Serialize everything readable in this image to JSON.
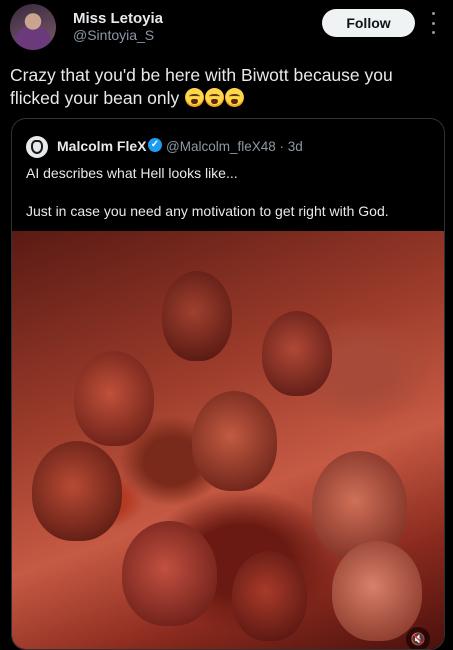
{
  "post": {
    "author_name": "Miss Letoyia",
    "author_handle": "@Sintoyia_S",
    "follow_label": "Follow",
    "text": "Crazy that you'd be here with Biwott because you flicked your bean only"
  },
  "quote": {
    "author_name": "Malcolm FleX",
    "author_handle": "@Malcolm_fleX48",
    "separator": "·",
    "time": "3d",
    "text_line1": "AI describes what Hell looks like...",
    "text_line2": "Just in case you need any motivation to get right with God."
  },
  "icons": {
    "more": "more-options-icon",
    "verified": "verified-badge-icon",
    "emoji": "loudly-crying-face-emoji",
    "mute": "volume-muted-icon"
  },
  "colors": {
    "background": "#000000",
    "text": "#e7e9ea",
    "secondary_text": "#8b98a5",
    "verified": "#1d9bf0",
    "follow_button_bg": "#eff3f4"
  }
}
